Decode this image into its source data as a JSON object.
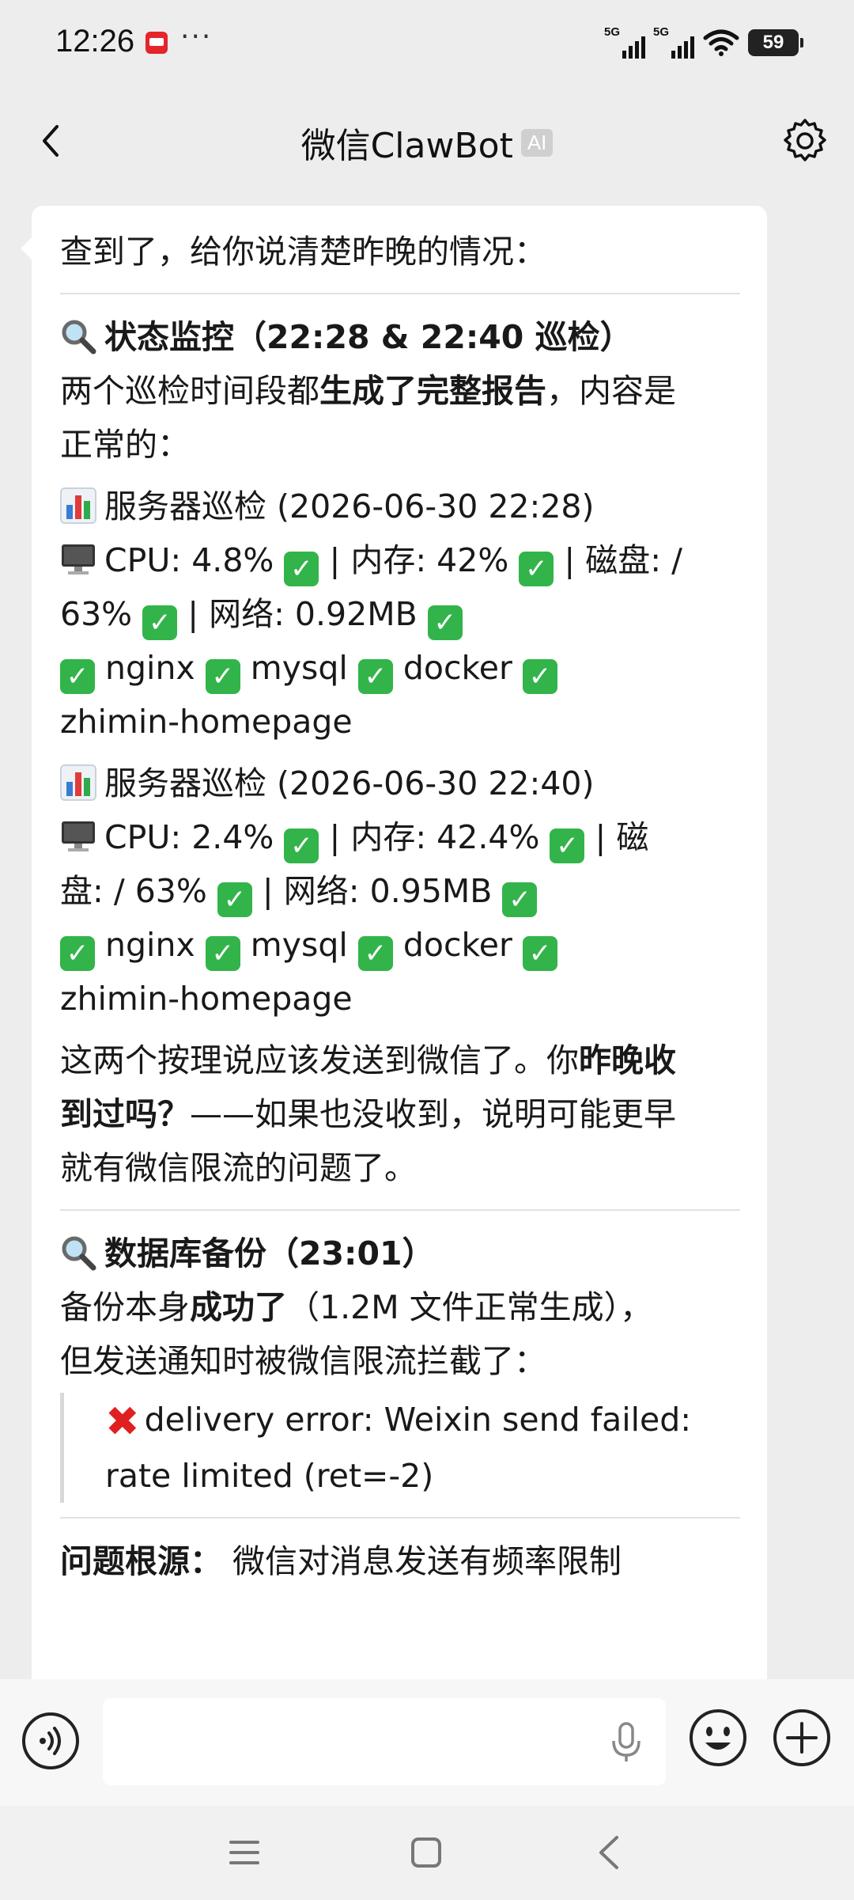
{
  "status_bar": {
    "time": "12:26",
    "more": "···",
    "signal1_label": "5G",
    "signal2_label": "5G",
    "battery": "59"
  },
  "nav": {
    "title": "微信ClawBot",
    "badge": "AI"
  },
  "message": {
    "intro": "查到了，给你说清楚昨晚的情况：",
    "section1": {
      "title": "状态监控（22:28 & 22:40 巡检）",
      "p1_a": "两个巡检时间段都",
      "p1_b": "生成了完整报告",
      "p1_c": "，内容是",
      "p1_d": "正常的：",
      "report1": {
        "header": "服务器巡检 (2026-06-30 22:28)",
        "l1_a": "CPU: 4.8%",
        "l1_b": "| 内存: 42%",
        "l1_c": "| 磁盘: /",
        "l2_a": "63%",
        "l2_b": "| 网络: 0.92MB",
        "nginx": "nginx",
        "mysql": "mysql",
        "docker": "docker",
        "homepage": "zhimin-homepage"
      },
      "report2": {
        "header": "服务器巡检 (2026-06-30 22:40)",
        "l1_a": "CPU: 2.4%",
        "l1_b": "| 内存: 42.4%",
        "l1_c": "| 磁",
        "l2_a": "盘: / 63%",
        "l2_b": "| 网络: 0.95MB",
        "nginx": "nginx",
        "mysql": "mysql",
        "docker": "docker",
        "homepage": "zhimin-homepage"
      },
      "p2_a": "这两个按理说应该发送到微信了。你",
      "p2_b": "昨晚收",
      "p2_c": "到过吗？",
      "p2_d": "——如果也没收到，说明可能更早",
      "p2_e": "就有微信限流的问题了。"
    },
    "section2": {
      "title": "数据库备份（23:01）",
      "p1_a": "备份本身",
      "p1_b": "成功了",
      "p1_c": "（1.2M 文件正常生成），",
      "p1_d": "但发送通知时被微信限流拦截了：",
      "quote_l1": "delivery error: Weixin send failed:",
      "quote_l2": "rate limited (ret=-2)"
    },
    "section3": {
      "label": "问题根源：",
      "text": "微信对消息发送有频率限制"
    }
  },
  "colors": {
    "background": "#ededed",
    "bubble": "#ffffff",
    "check_green": "#32b44a",
    "error_red": "#e02020"
  },
  "icons": [
    "back-icon",
    "settings-icon",
    "magnifier-icon",
    "bar-chart-icon",
    "monitor-icon",
    "check-icon",
    "cross-icon",
    "voice-icon",
    "mic-icon",
    "emoji-icon",
    "plus-icon"
  ]
}
